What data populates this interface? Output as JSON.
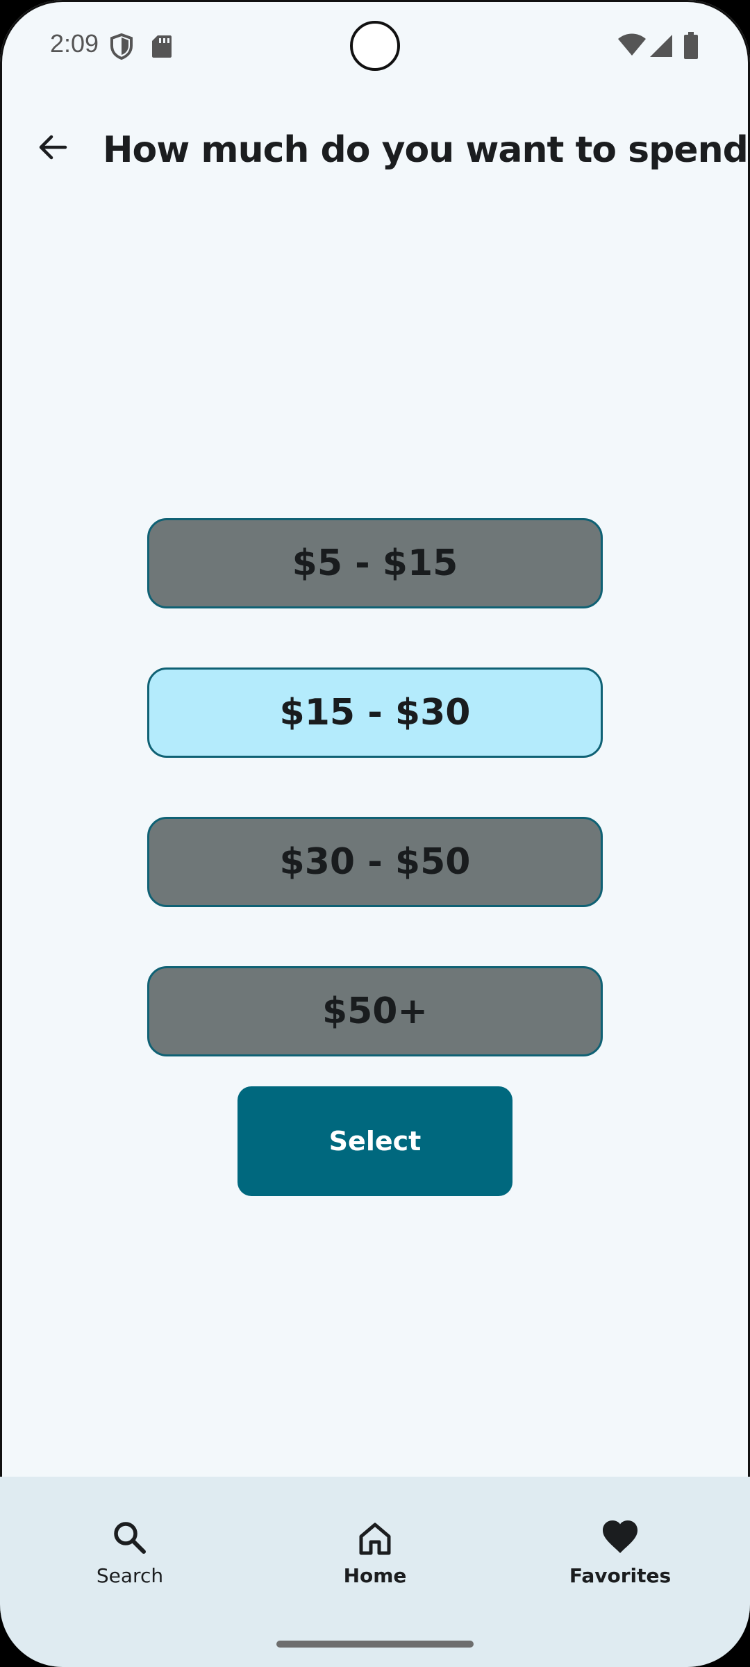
{
  "status_bar": {
    "time": "2:09",
    "icons": [
      "shield-icon",
      "sd-card-icon",
      "wifi-icon",
      "signal-icon",
      "battery-icon"
    ]
  },
  "header": {
    "back_icon": "arrow-back-icon",
    "title": "How much do you want to spend?"
  },
  "options": [
    {
      "label": "$5 - $15",
      "selected": false
    },
    {
      "label": "$15 - $30",
      "selected": true
    },
    {
      "label": "$30 - $50",
      "selected": false
    },
    {
      "label": "$50+",
      "selected": false
    }
  ],
  "select_button": {
    "label": "Select"
  },
  "bottom_nav": {
    "items": [
      {
        "label": "Search",
        "icon": "search-icon",
        "bold": false
      },
      {
        "label": "Home",
        "icon": "home-icon",
        "bold": true
      },
      {
        "label": "Favorites",
        "icon": "heart-icon",
        "bold": true
      }
    ]
  },
  "colors": {
    "background": "#f3f8fb",
    "option_unselected": "#6f7778",
    "option_selected": "#b4ebfc",
    "option_border": "#0f6174",
    "primary": "#00687e",
    "nav_background": "#dfebf1"
  }
}
